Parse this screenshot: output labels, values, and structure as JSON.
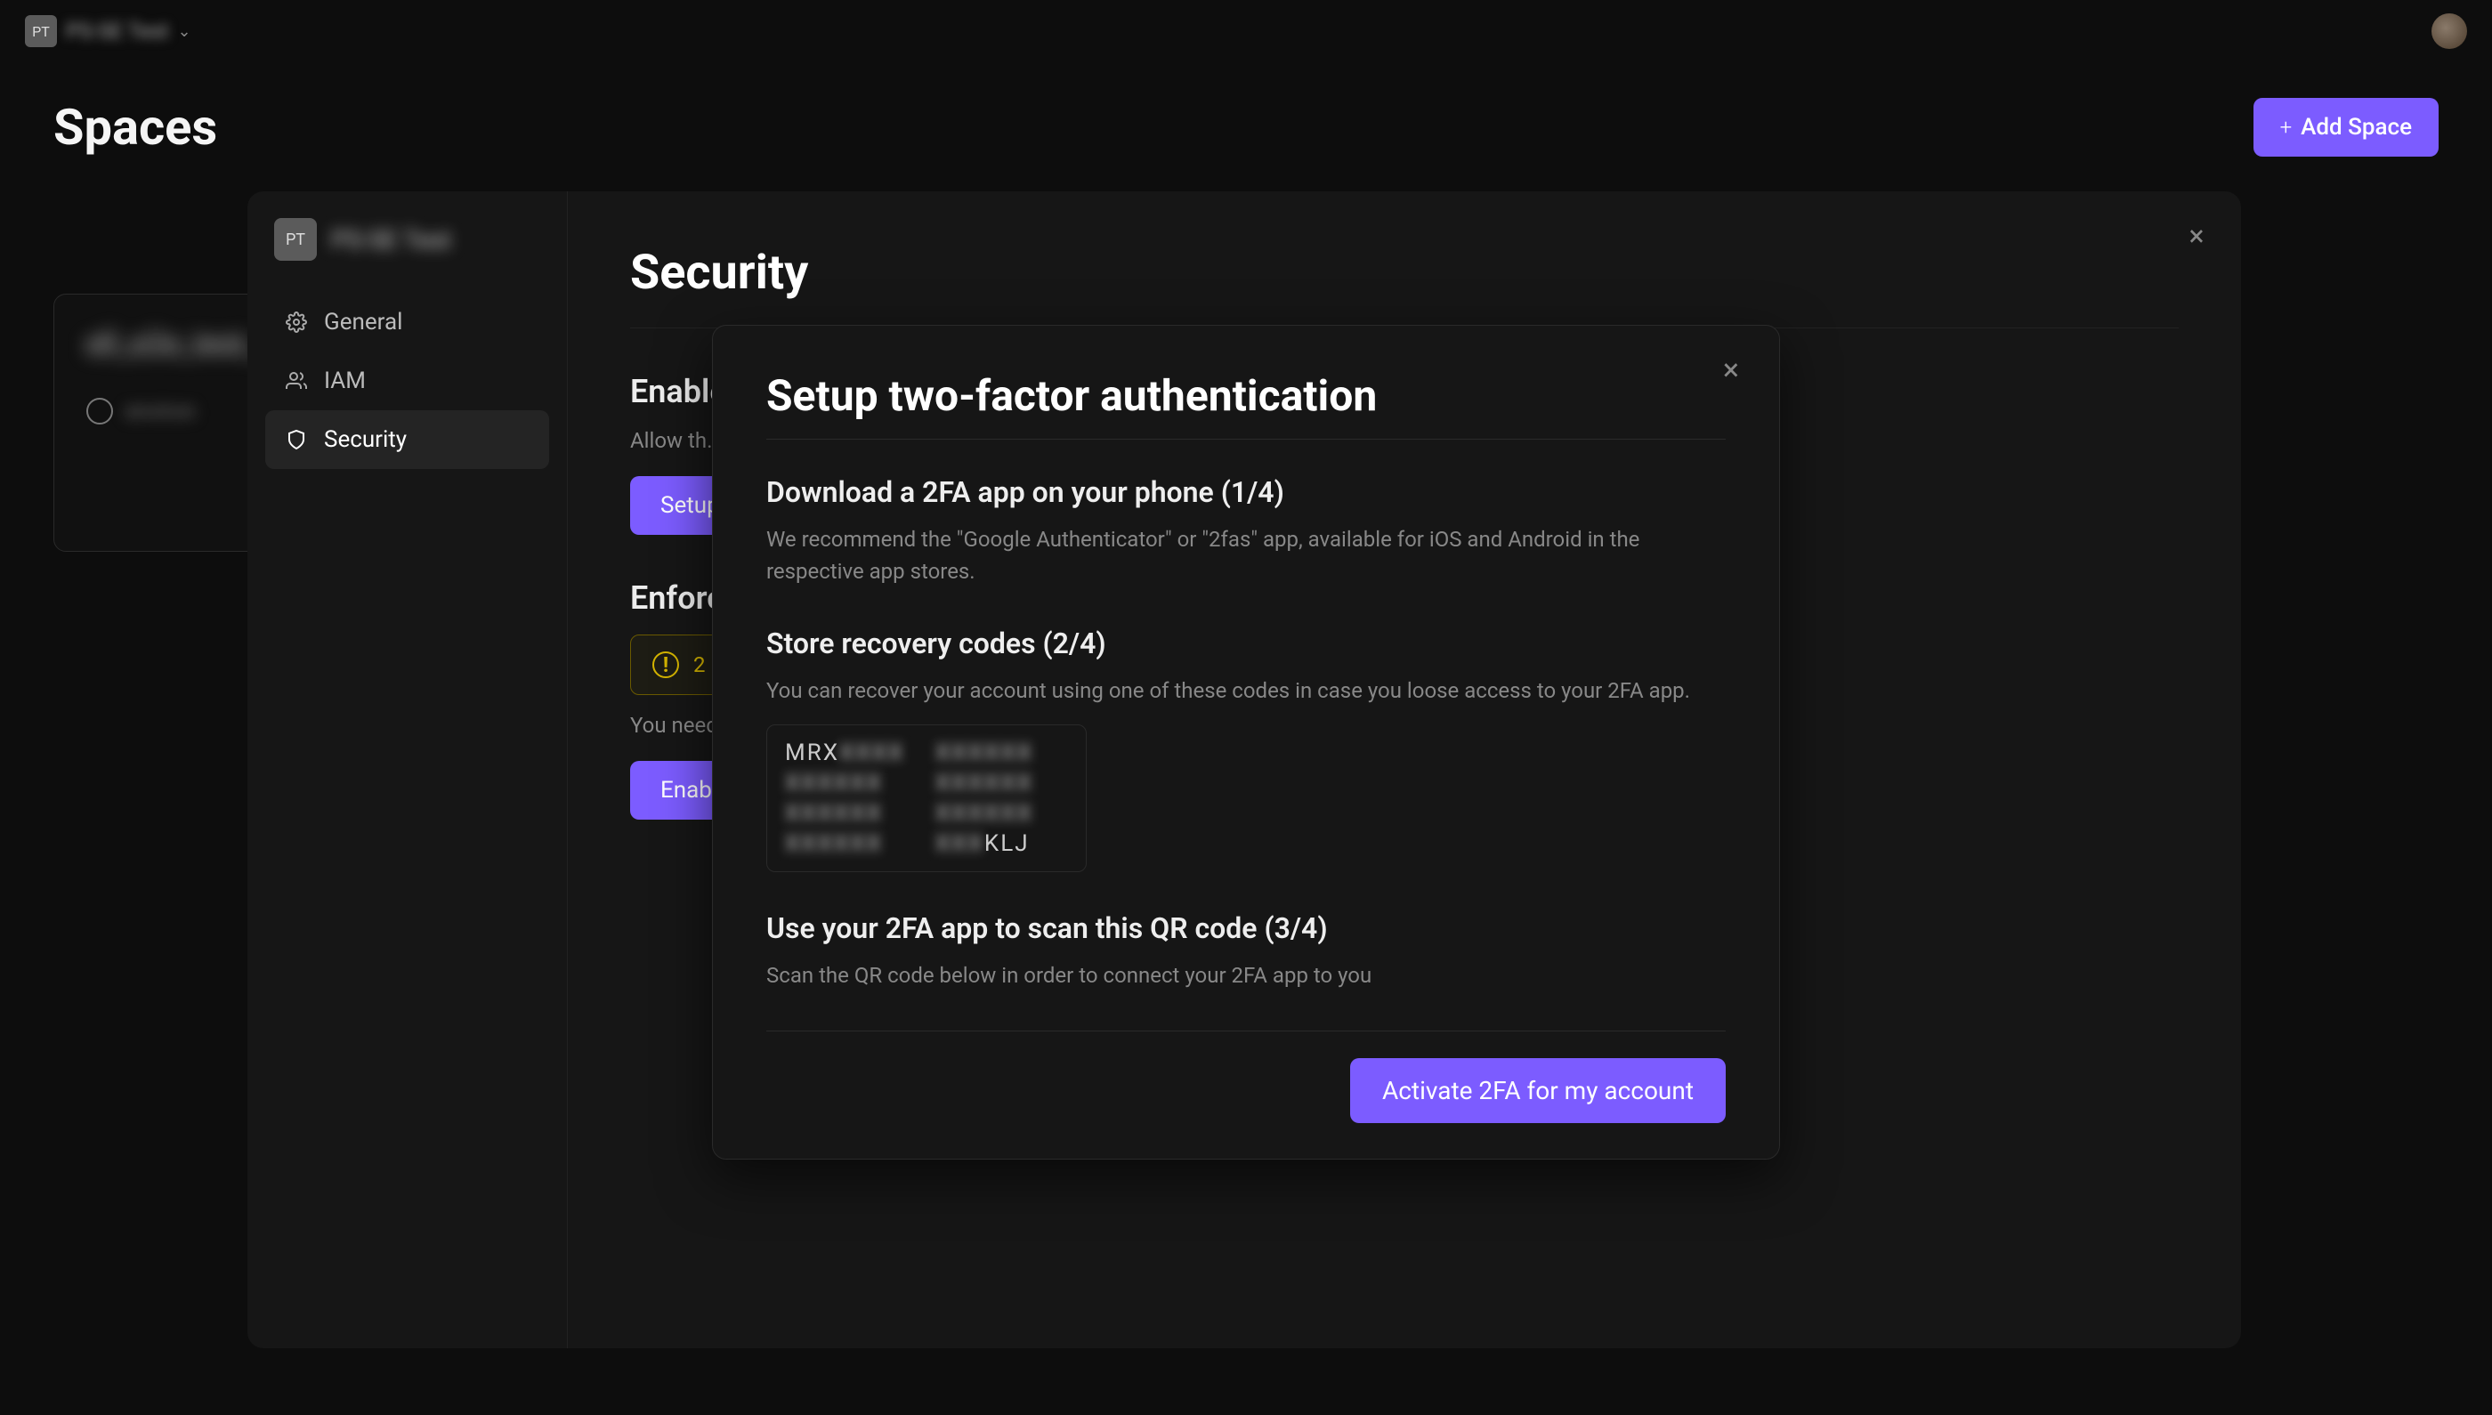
{
  "topbar": {
    "org_badge": "PT",
    "org_name": "PS-SE Test"
  },
  "spaces": {
    "title": "Spaces",
    "add_button": "Add Space",
    "card_title": "ell_e2e_test_",
    "card_env_label": "environ"
  },
  "settings": {
    "badge": "PT",
    "space_title": "PS-SE Test",
    "nav": {
      "general": "General",
      "iam": "IAM",
      "security": "Security"
    },
    "content": {
      "title": "Security",
      "enable_section_title": "Enable",
      "enable_section_desc": "Allow th… SSO pr…",
      "setup_button": "Setup",
      "enforce_section_title": "Enforce",
      "warning_text": "2",
      "enforce_desc": "You need… enable…",
      "enable_button": "Enable"
    }
  },
  "modal": {
    "title": "Setup two-factor authentication",
    "step1_title": "Download a 2FA app on your phone (1/4)",
    "step1_desc": "We recommend the \"Google Authenticator\" or \"2fas\" app, available for iOS and Android in the respective app stores.",
    "step2_title": "Store recovery codes (2/4)",
    "step2_desc": "You can recover your account using one of these codes in case you loose access to your 2FA app.",
    "recovery_codes": [
      {
        "visible_prefix": "MRX",
        "visible_suffix": ""
      },
      {
        "visible_prefix": "",
        "visible_suffix": ""
      },
      {
        "visible_prefix": "",
        "visible_suffix": ""
      },
      {
        "visible_prefix": "",
        "visible_suffix": ""
      },
      {
        "visible_prefix": "",
        "visible_suffix": ""
      },
      {
        "visible_prefix": "",
        "visible_suffix": ""
      },
      {
        "visible_prefix": "",
        "visible_suffix": ""
      },
      {
        "visible_prefix": "",
        "visible_suffix": "KLJ"
      }
    ],
    "step3_title": "Use your 2FA app to scan this QR code (3/4)",
    "step3_desc": "Scan the QR code below in order to connect your 2FA app to you",
    "activate_button": "Activate 2FA for my account"
  }
}
